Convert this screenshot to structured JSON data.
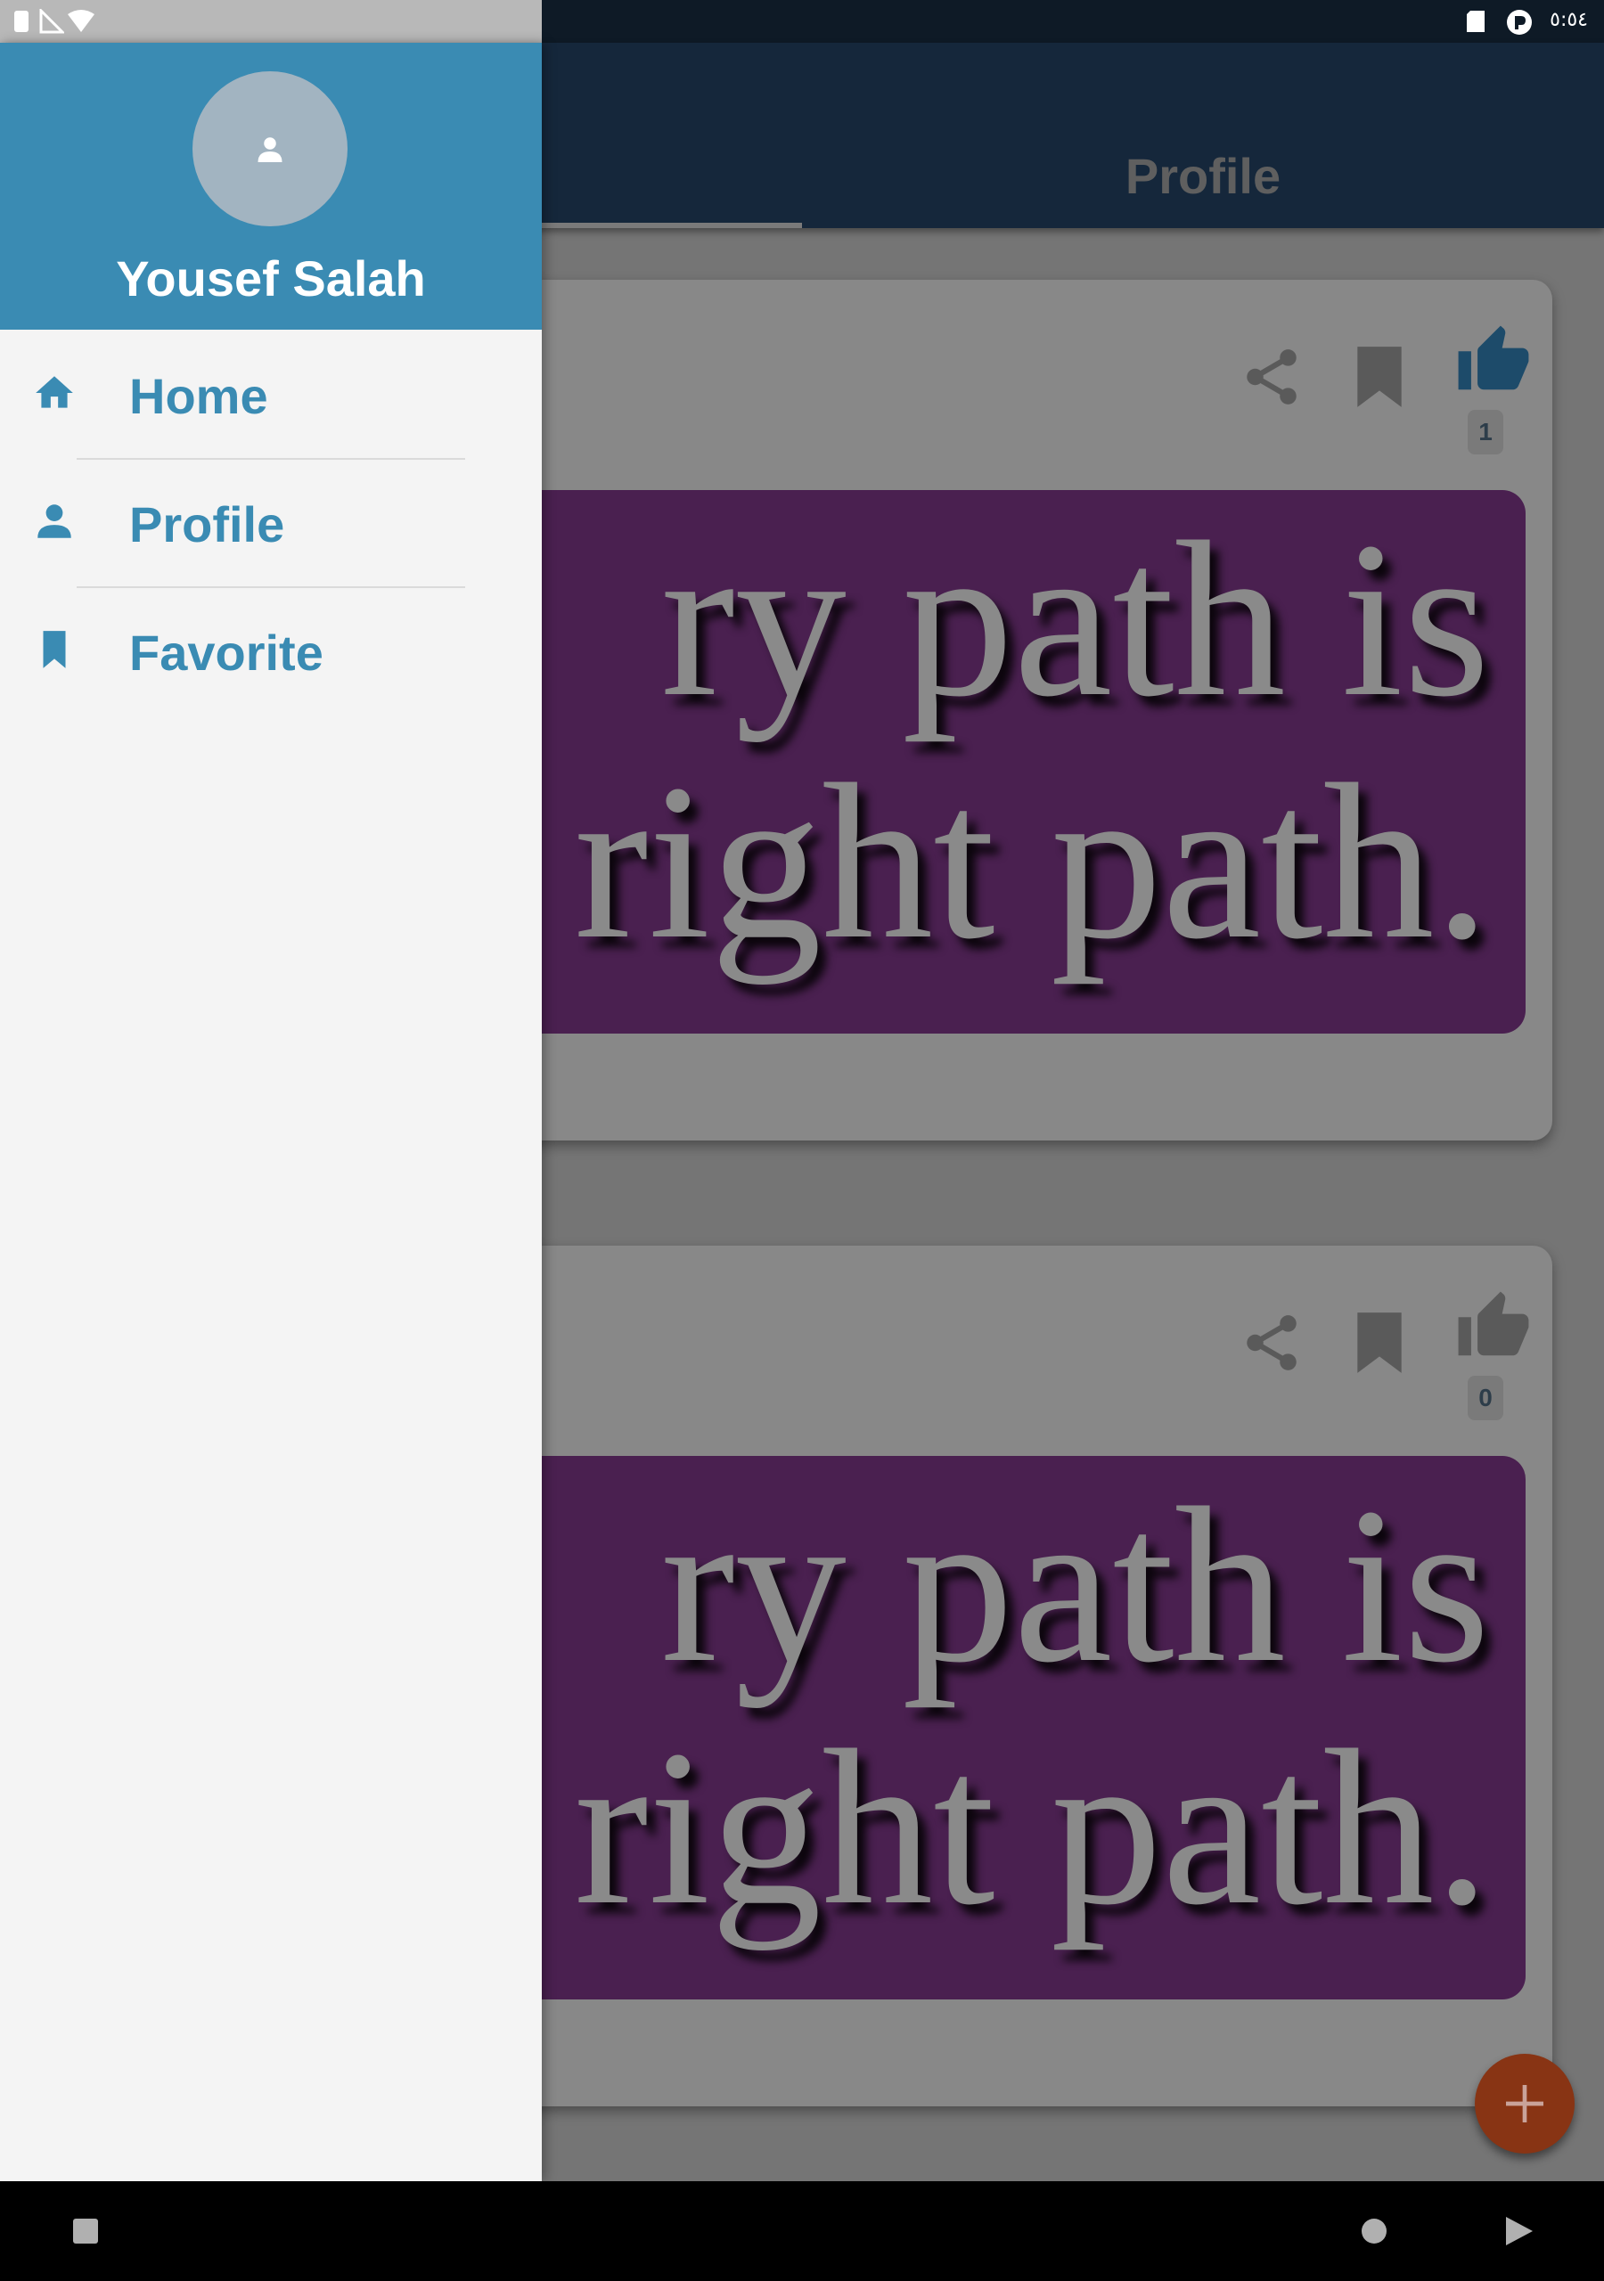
{
  "status_bar": {
    "time": "٥:٥٤",
    "left_icons": [
      "sim-card-icon",
      "signal-icon",
      "wifi-icon"
    ],
    "right_icons": [
      "sd-card-icon",
      "app-notification-icon"
    ]
  },
  "app_bar": {
    "tab_label": "Profile"
  },
  "posts": [
    {
      "like_count": "1",
      "quote_lines": [
        "ry path is",
        "right path."
      ]
    },
    {
      "like_count": "0",
      "quote_lines": [
        "ry path is",
        "right path."
      ]
    }
  ],
  "drawer": {
    "user_name": "Yousef Salah",
    "items": [
      {
        "label": "Home",
        "icon": "home-icon"
      },
      {
        "label": "Profile",
        "icon": "person-icon"
      },
      {
        "label": "Favorite",
        "icon": "bookmark-icon"
      }
    ]
  },
  "colors": {
    "drawer_header": "#3a8bb3",
    "drawer_item_text": "#3a8bb3",
    "app_bar": "#15273b",
    "fab": "#883414"
  }
}
